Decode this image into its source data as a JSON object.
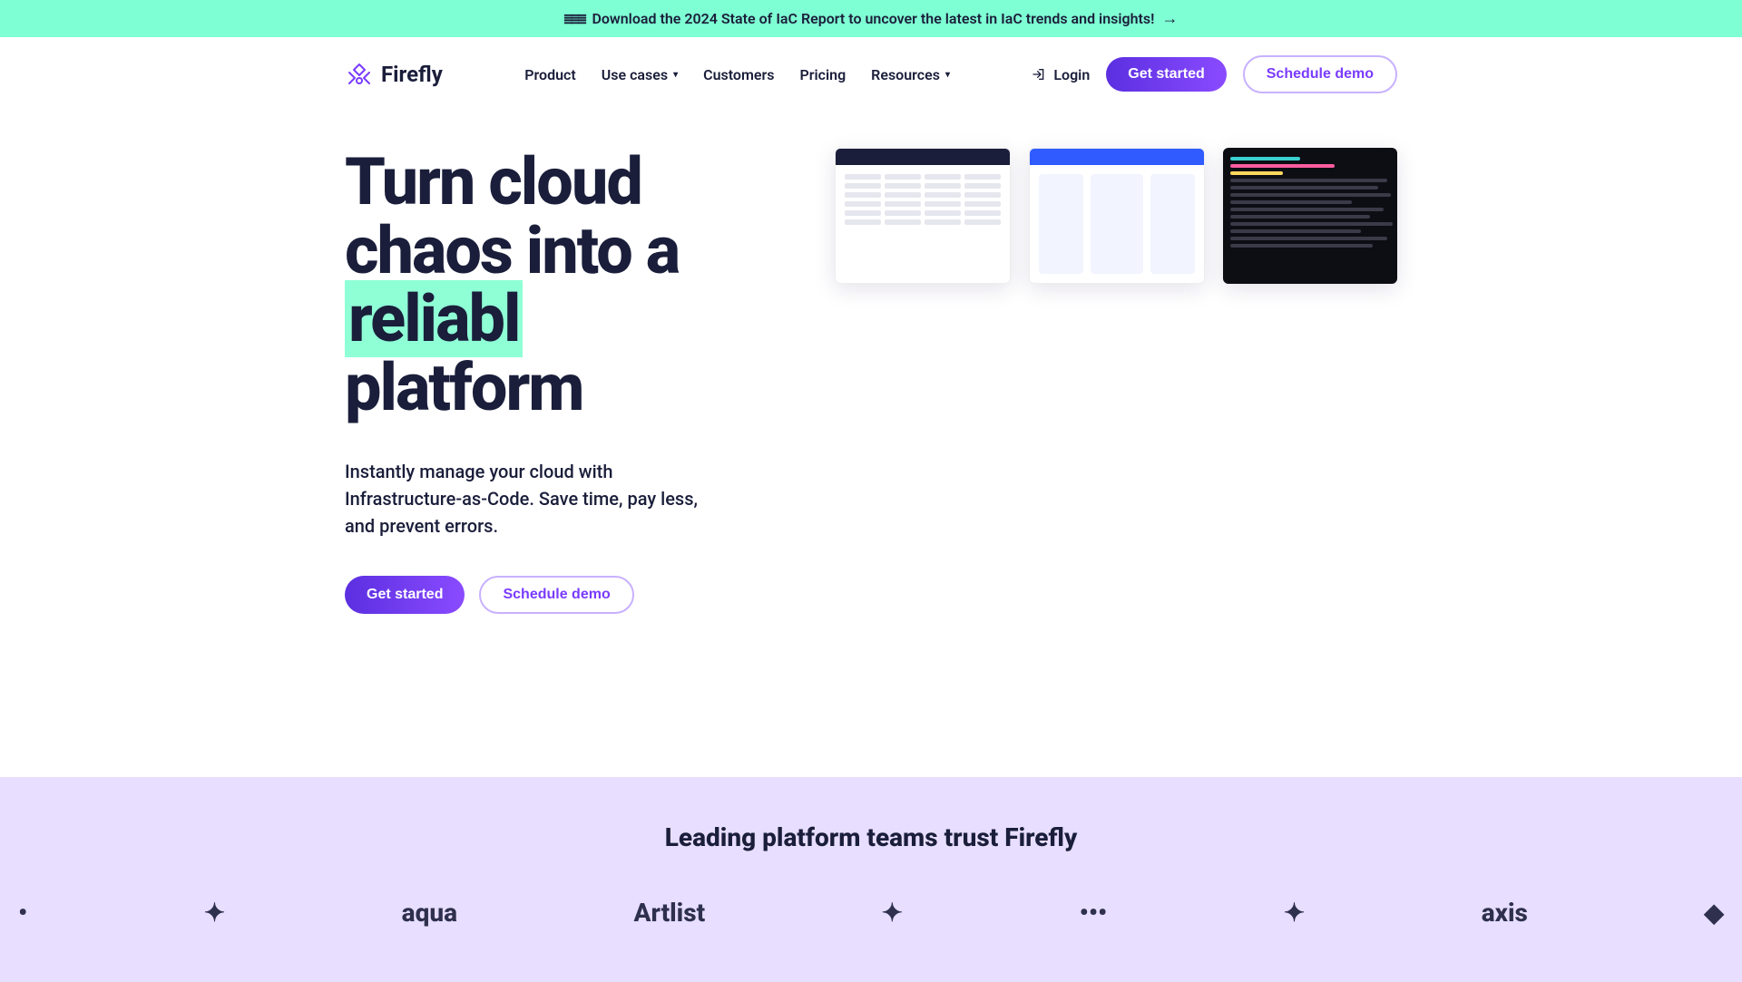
{
  "banner": {
    "icon": "≣≣≣",
    "text": "Download the 2024 State of IaC Report to uncover the latest in IaC trends and insights!",
    "arrow": "→"
  },
  "logo": {
    "text": "Firefly"
  },
  "nav": {
    "product": "Product",
    "use_cases": "Use cases",
    "customers": "Customers",
    "pricing": "Pricing",
    "resources": "Resources"
  },
  "header": {
    "login": "Login",
    "get_started": "Get started",
    "schedule_demo": "Schedule demo"
  },
  "hero": {
    "title_pre": "Turn cloud chaos into a",
    "title_highlight": "reliabl",
    "title_post": "platform",
    "subtitle": "Instantly manage your cloud with Infrastructure-as-Code. Save time, pay less, and prevent errors.",
    "cta_primary": "Get started",
    "cta_secondary": "Schedule demo"
  },
  "trust": {
    "heading": "Leading platform teams trust Firefly",
    "brands": [
      "aqua",
      "Artlist",
      "axis"
    ]
  },
  "colors": {
    "accent": "#7A3BFF",
    "banner_bg": "#7FFFD4",
    "highlight_bg": "#8FFFD6",
    "trust_bg": "#E8DEFF"
  }
}
